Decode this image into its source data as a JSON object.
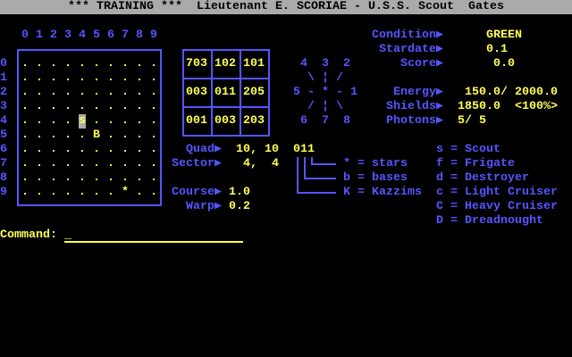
{
  "title": "*** TRAINING ***  Lieutenant E. SCORIAE - U.S.S. Scout  Gates",
  "colors": {
    "label": "#5555ff",
    "value": "#ffff55",
    "title_bar": "#aaaaaa",
    "highlight": "#aaaaaa"
  },
  "sector_map": {
    "column_headers": [
      "0",
      "1",
      "2",
      "3",
      "4",
      "5",
      "6",
      "7",
      "8",
      "9"
    ],
    "row_headers": [
      "0",
      "1",
      "2",
      "3",
      "4",
      "5",
      "6",
      "7",
      "8",
      "9"
    ],
    "rows": [
      "..........",
      "..........",
      "..........",
      "..........",
      "....s.....",
      ".....B....",
      "..........",
      "..........",
      "..........",
      ".......*.."
    ],
    "highlighted_cell": {
      "row": 4,
      "col": 4
    }
  },
  "quadrant_scan": [
    [
      "703",
      "102",
      "101"
    ],
    [
      "003",
      "011",
      "205"
    ],
    [
      "001",
      "003",
      "203"
    ]
  ],
  "compass": {
    "row1": " 4  3  2",
    "row2": "  \\ ¦ /",
    "row3": "5 - * - 1",
    "row4": "  / ¦ \\",
    "row5": " 6  7  8"
  },
  "status": {
    "condition": {
      "label": "Condition",
      "value": "GREEN"
    },
    "stardate": {
      "label": "Stardate",
      "value": "0.1"
    },
    "score": {
      "label": "Score",
      "value": "0.0"
    },
    "energy": {
      "label": "Energy",
      "value": "150.0/ 2000.0"
    },
    "shields": {
      "label": "Shields",
      "value": "1850.0  <100%>"
    },
    "photons": {
      "label": "Photons",
      "value": "5/ 5"
    }
  },
  "nav": {
    "quad": {
      "label": "Quad",
      "value": "10, 10"
    },
    "sector": {
      "label": "Sector",
      "value": " 4,  4"
    },
    "course": {
      "label": "Course",
      "value": "1.0"
    },
    "warp": {
      "label": "Warp",
      "value": "0.2"
    }
  },
  "quad_code": "011",
  "code_legend": [
    "* = stars",
    "b = bases",
    "K = Kazzims"
  ],
  "ship_legend": [
    "s = Scout",
    "f = Frigate",
    "d = Destroyer",
    "c = Light Cruiser",
    "C = Heavy Cruiser",
    "D = Dreadnought"
  ],
  "command": {
    "label": "Command:",
    "value": "_"
  },
  "arrow": "▶"
}
